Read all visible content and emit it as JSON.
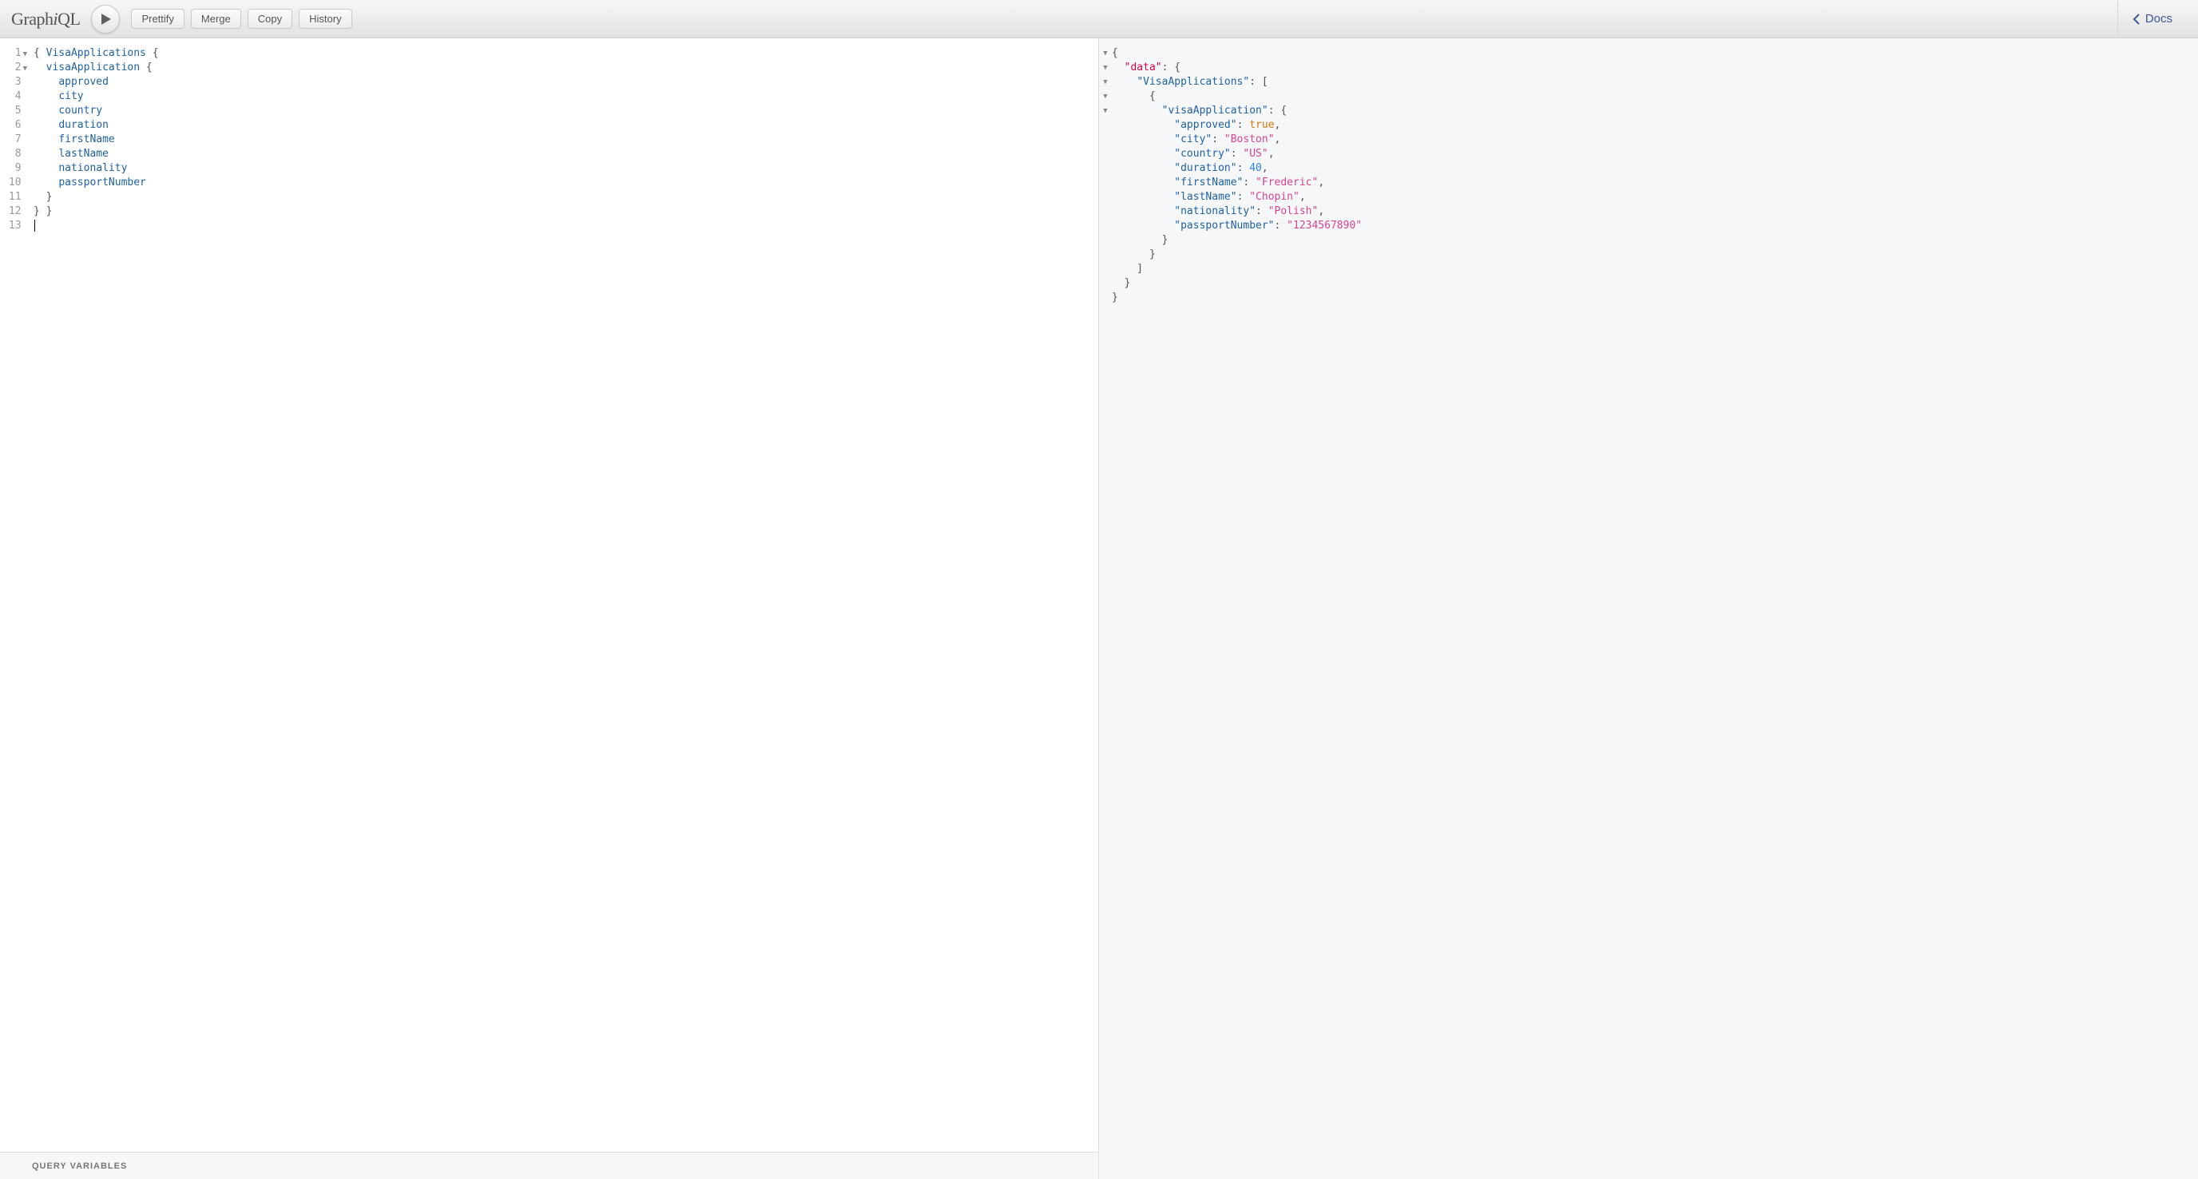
{
  "app": {
    "name_pre": "Graph",
    "name_i": "i",
    "name_post": "QL"
  },
  "toolbar": {
    "play_title": "Execute Query (Ctrl-Enter)",
    "buttons": {
      "prettify": "Prettify",
      "merge": "Merge",
      "copy": "Copy",
      "history": "History"
    },
    "docs": "Docs"
  },
  "query_editor": {
    "lines": [
      {
        "n": 1,
        "fold": true,
        "tokens": [
          [
            "pn",
            "{ "
          ],
          [
            "def",
            "VisaApplications"
          ],
          [
            "pn",
            " {"
          ]
        ]
      },
      {
        "n": 2,
        "fold": true,
        "tokens": [
          [
            "pn",
            "  "
          ],
          [
            "kw",
            "visaApplication"
          ],
          [
            "pn",
            " {"
          ]
        ]
      },
      {
        "n": 3,
        "fold": false,
        "tokens": [
          [
            "pn",
            "    "
          ],
          [
            "kw",
            "approved"
          ]
        ]
      },
      {
        "n": 4,
        "fold": false,
        "tokens": [
          [
            "pn",
            "    "
          ],
          [
            "kw",
            "city"
          ]
        ]
      },
      {
        "n": 5,
        "fold": false,
        "tokens": [
          [
            "pn",
            "    "
          ],
          [
            "kw",
            "country"
          ]
        ]
      },
      {
        "n": 6,
        "fold": false,
        "tokens": [
          [
            "pn",
            "    "
          ],
          [
            "kw",
            "duration"
          ]
        ]
      },
      {
        "n": 7,
        "fold": false,
        "tokens": [
          [
            "pn",
            "    "
          ],
          [
            "kw",
            "firstName"
          ]
        ]
      },
      {
        "n": 8,
        "fold": false,
        "tokens": [
          [
            "pn",
            "    "
          ],
          [
            "kw",
            "lastName"
          ]
        ]
      },
      {
        "n": 9,
        "fold": false,
        "tokens": [
          [
            "pn",
            "    "
          ],
          [
            "kw",
            "nationality"
          ]
        ]
      },
      {
        "n": 10,
        "fold": false,
        "tokens": [
          [
            "pn",
            "    "
          ],
          [
            "kw",
            "passportNumber"
          ]
        ]
      },
      {
        "n": 11,
        "fold": false,
        "tokens": [
          [
            "pn",
            "  }"
          ]
        ]
      },
      {
        "n": 12,
        "fold": false,
        "tokens": [
          [
            "pn",
            "} }"
          ]
        ]
      },
      {
        "n": 13,
        "fold": false,
        "tokens": [],
        "cursor": true
      }
    ],
    "variables_label": "Query Variables"
  },
  "result": {
    "lines": [
      {
        "fold": true,
        "tokens": [
          [
            "pn",
            "{"
          ]
        ]
      },
      {
        "fold": true,
        "tokens": [
          [
            "pn",
            "  "
          ],
          [
            "keyd",
            "\"data\""
          ],
          [
            "pn",
            ": {"
          ]
        ]
      },
      {
        "fold": true,
        "tokens": [
          [
            "pn",
            "    "
          ],
          [
            "key",
            "\"VisaApplications\""
          ],
          [
            "pn",
            ": ["
          ]
        ]
      },
      {
        "fold": true,
        "tokens": [
          [
            "pn",
            "      {"
          ]
        ]
      },
      {
        "fold": true,
        "tokens": [
          [
            "pn",
            "        "
          ],
          [
            "key",
            "\"visaApplication\""
          ],
          [
            "pn",
            ": {"
          ]
        ]
      },
      {
        "fold": false,
        "tokens": [
          [
            "pn",
            "          "
          ],
          [
            "key",
            "\"approved\""
          ],
          [
            "pn",
            ": "
          ],
          [
            "bool",
            "true"
          ],
          [
            "pn",
            ","
          ]
        ]
      },
      {
        "fold": false,
        "tokens": [
          [
            "pn",
            "          "
          ],
          [
            "key",
            "\"city\""
          ],
          [
            "pn",
            ": "
          ],
          [
            "str",
            "\"Boston\""
          ],
          [
            "pn",
            ","
          ]
        ]
      },
      {
        "fold": false,
        "tokens": [
          [
            "pn",
            "          "
          ],
          [
            "key",
            "\"country\""
          ],
          [
            "pn",
            ": "
          ],
          [
            "str",
            "\"US\""
          ],
          [
            "pn",
            ","
          ]
        ]
      },
      {
        "fold": false,
        "tokens": [
          [
            "pn",
            "          "
          ],
          [
            "key",
            "\"duration\""
          ],
          [
            "pn",
            ": "
          ],
          [
            "num",
            "40"
          ],
          [
            "pn",
            ","
          ]
        ]
      },
      {
        "fold": false,
        "tokens": [
          [
            "pn",
            "          "
          ],
          [
            "key",
            "\"firstName\""
          ],
          [
            "pn",
            ": "
          ],
          [
            "str",
            "\"Frederic\""
          ],
          [
            "pn",
            ","
          ]
        ]
      },
      {
        "fold": false,
        "tokens": [
          [
            "pn",
            "          "
          ],
          [
            "key",
            "\"lastName\""
          ],
          [
            "pn",
            ": "
          ],
          [
            "str",
            "\"Chopin\""
          ],
          [
            "pn",
            ","
          ]
        ]
      },
      {
        "fold": false,
        "tokens": [
          [
            "pn",
            "          "
          ],
          [
            "key",
            "\"nationality\""
          ],
          [
            "pn",
            ": "
          ],
          [
            "str",
            "\"Polish\""
          ],
          [
            "pn",
            ","
          ]
        ]
      },
      {
        "fold": false,
        "tokens": [
          [
            "pn",
            "          "
          ],
          [
            "key",
            "\"passportNumber\""
          ],
          [
            "pn",
            ": "
          ],
          [
            "str",
            "\"1234567890\""
          ]
        ]
      },
      {
        "fold": false,
        "tokens": [
          [
            "pn",
            "        }"
          ]
        ]
      },
      {
        "fold": false,
        "tokens": [
          [
            "pn",
            "      }"
          ]
        ]
      },
      {
        "fold": false,
        "tokens": [
          [
            "pn",
            "    ]"
          ]
        ]
      },
      {
        "fold": false,
        "tokens": [
          [
            "pn",
            "  }"
          ]
        ]
      },
      {
        "fold": false,
        "tokens": [
          [
            "pn",
            "}"
          ]
        ]
      }
    ]
  }
}
